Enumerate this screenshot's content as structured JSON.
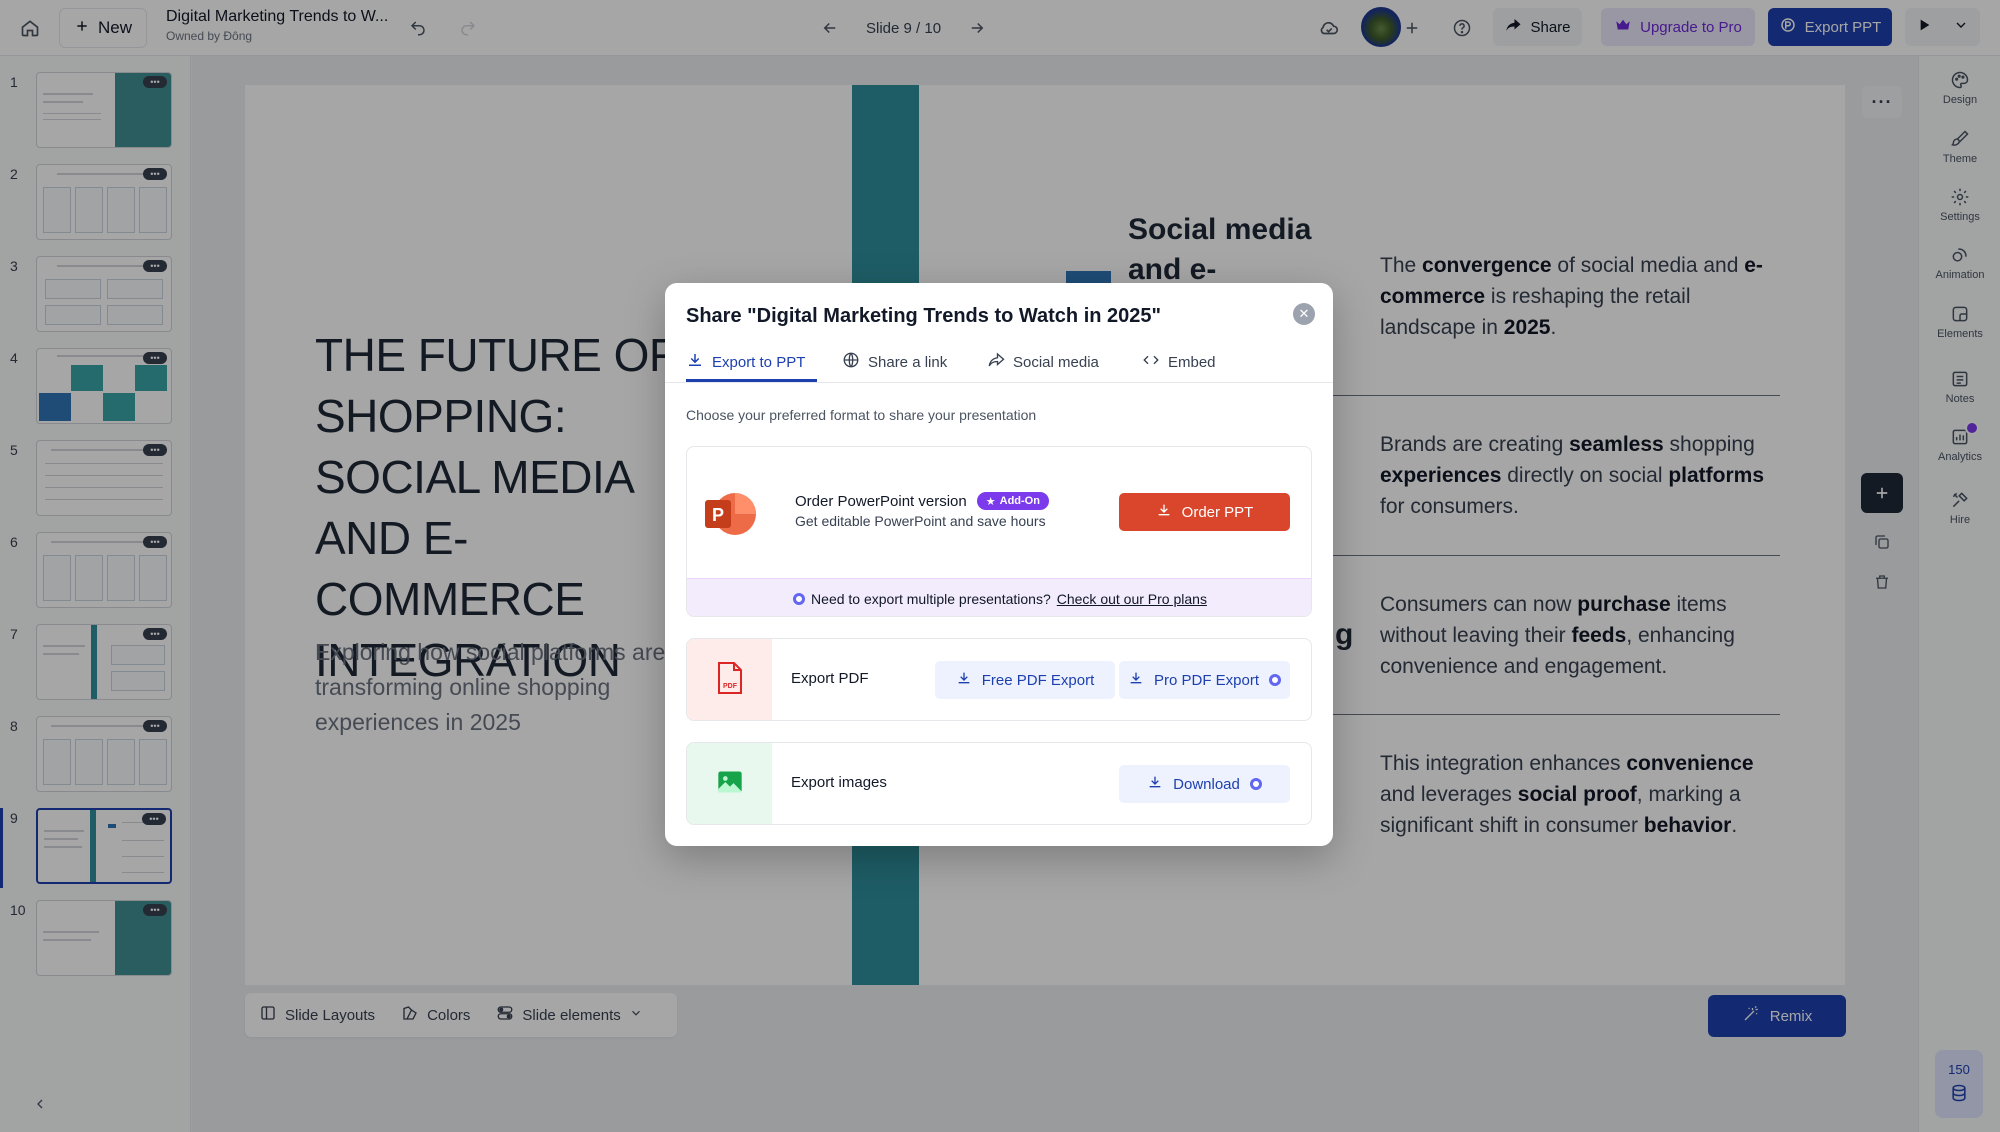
{
  "topbar": {
    "new_label": "New",
    "doc_title": "Digital Marketing Trends to W...",
    "doc_owner": "Owned by Đông",
    "slide_indicator": "Slide 9 / 10",
    "share_label": "Share",
    "upgrade_label": "Upgrade to Pro",
    "export_label": "Export PPT"
  },
  "thumbnails": [
    {
      "num": "1"
    },
    {
      "num": "2"
    },
    {
      "num": "3"
    },
    {
      "num": "4"
    },
    {
      "num": "5"
    },
    {
      "num": "6"
    },
    {
      "num": "7"
    },
    {
      "num": "8"
    },
    {
      "num": "9"
    },
    {
      "num": "10"
    }
  ],
  "slide": {
    "title": "THE FUTURE OF SHOPPING: SOCIAL MEDIA AND E-COMMERCE INTEGRATION",
    "subtitle": "Exploring how social platforms are transforming online shopping experiences in 2025",
    "heading": "Social media and e-",
    "heading_tail": "g"
  },
  "bottom_bar": {
    "layouts": "Slide Layouts",
    "colors": "Colors",
    "elements": "Slide elements",
    "remix": "Remix"
  },
  "right_rail": {
    "design": "Design",
    "theme": "Theme",
    "settings": "Settings",
    "animation": "Animation",
    "elements": "Elements",
    "notes": "Notes",
    "analytics": "Analytics",
    "hire": "Hire",
    "credits": "150"
  },
  "modal": {
    "title": "Share \"Digital Marketing Trends to Watch in 2025\"",
    "tabs": {
      "export": "Export to PPT",
      "link": "Share a link",
      "social": "Social media",
      "embed": "Embed"
    },
    "description": "Choose your preferred format to share your presentation",
    "ppt": {
      "title": "Order PowerPoint version",
      "badge": "Add-On",
      "subtitle": "Get editable PowerPoint and save hours",
      "button": "Order PPT",
      "footer_text": "Need to export multiple presentations?",
      "footer_link": "Check out our Pro plans"
    },
    "pdf": {
      "label": "Export PDF",
      "free_button": "Free PDF Export",
      "pro_button": "Pro PDF Export"
    },
    "images": {
      "label": "Export images",
      "button": "Download"
    }
  },
  "colors": {
    "brand_blue": "#1e40af",
    "teal": "#2f8f9d",
    "order_red": "#d9462b",
    "addon_purple": "#7c3aed"
  }
}
